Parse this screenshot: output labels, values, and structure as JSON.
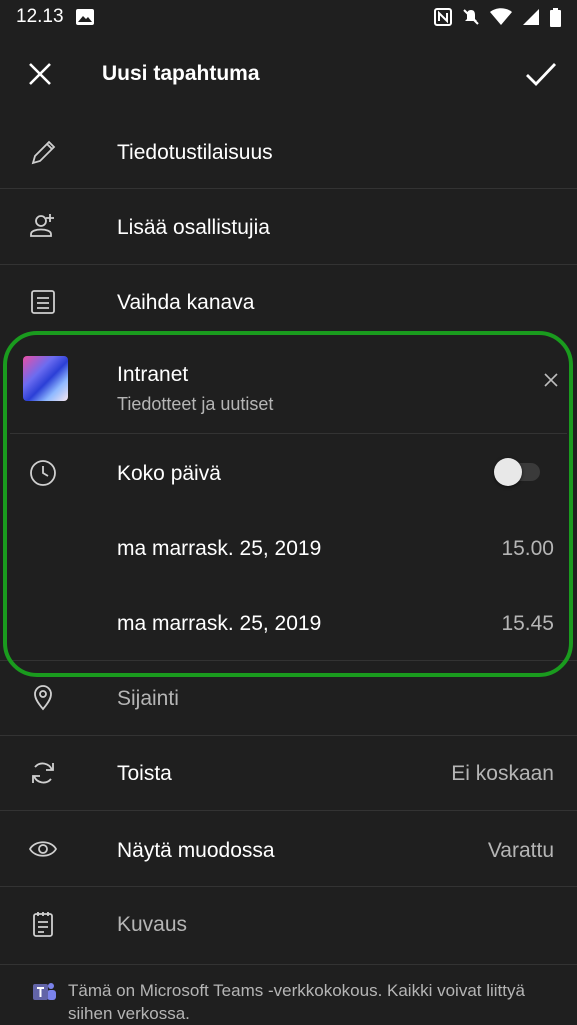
{
  "status_bar": {
    "time": "12.13"
  },
  "app_bar": {
    "title": "Uusi tapahtuma"
  },
  "rows": {
    "event_type": {
      "label": "Tiedotustilaisuus"
    },
    "add_participants": {
      "label": "Lisää osallistujia"
    },
    "change_channel": {
      "label": "Vaihda kanava"
    },
    "channel": {
      "name": "Intranet",
      "subtitle": "Tiedotteet ja uutiset"
    },
    "all_day": {
      "label": "Koko päivä",
      "enabled": false
    },
    "start": {
      "date": "ma marrask. 25, 2019",
      "time": "15.00"
    },
    "end": {
      "date": "ma marrask. 25, 2019",
      "time": "15.45"
    },
    "location": {
      "placeholder": "Sijainti"
    },
    "repeat": {
      "label": "Toista",
      "value": "Ei koskaan"
    },
    "show_as": {
      "label": "Näytä muodossa",
      "value": "Varattu"
    },
    "description": {
      "placeholder": "Kuvaus"
    }
  },
  "footer": {
    "text": "Tämä on Microsoft Teams -verkkokokous. Kaikki voivat liittyä siihen verkossa."
  },
  "colors": {
    "background": "#1f1f1f",
    "highlight": "#1a9b1e",
    "teams_purple": "#6264a7"
  }
}
